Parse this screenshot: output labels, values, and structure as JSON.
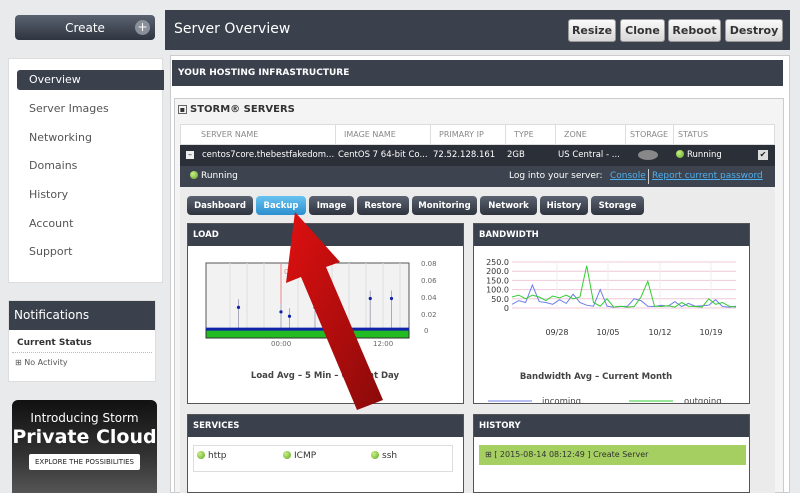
{
  "sidebar": {
    "create_label": "Create",
    "create_plus": "+",
    "items": [
      {
        "label": "Overview",
        "active": true
      },
      {
        "label": "Server Images"
      },
      {
        "label": "Networking"
      },
      {
        "label": "Domains"
      },
      {
        "label": "History"
      },
      {
        "label": "Account"
      },
      {
        "label": "Support"
      }
    ]
  },
  "notifications": {
    "title": "Notifications",
    "current_status": "Current Status",
    "entry": "No Activity"
  },
  "ad": {
    "line1": "Introducing Storm",
    "line2": "Private Cloud",
    "button": "EXPLORE THE POSSIBILITIES"
  },
  "header": {
    "title": "Server Overview",
    "buttons": [
      "Resize",
      "Clone",
      "Reboot",
      "Destroy"
    ]
  },
  "infra_title": "YOUR HOSTING INFRASTRUCTURE",
  "storm_title": "STORM® SERVERS",
  "table": {
    "columns": [
      "SERVER NAME",
      "IMAGE NAME",
      "PRIMARY IP",
      "TYPE",
      "ZONE",
      "STORAGE",
      "STATUS"
    ],
    "row": {
      "name": "centos7core.thebestfakedom...",
      "image": "CentOS 7 64-bit Co...",
      "ip": "72.52.128.161",
      "type": "2GB",
      "zone": "US Central - ...",
      "status": "Running",
      "checked": true
    }
  },
  "status_bar": {
    "status": "Running",
    "login_label": "Log into your server:",
    "console": "Console",
    "report": "Report current password"
  },
  "tabs": [
    {
      "label": "Dashboard"
    },
    {
      "label": "Backup",
      "active": true
    },
    {
      "label": "Image"
    },
    {
      "label": "Restore"
    },
    {
      "label": "Monitoring"
    },
    {
      "label": "Network"
    },
    {
      "label": "History"
    },
    {
      "label": "Storage"
    }
  ],
  "load": {
    "title": "LOAD",
    "caption": "Load Avg – 5 Min – Current Day",
    "marker": "Oct 21",
    "yticks": [
      "0.08",
      "0.06",
      "0.04",
      "0.02",
      "0"
    ],
    "xticks": [
      "00:00",
      "12:00"
    ],
    "spikes": [
      {
        "t": -5,
        "v": 0.03
      },
      {
        "t": 0,
        "v": 0.025
      },
      {
        "t": 1,
        "v": 0.02
      },
      {
        "t": 4,
        "v": 0.03
      },
      {
        "t": 10.5,
        "v": 0.04
      },
      {
        "t": 13,
        "v": 0.04
      }
    ],
    "baseline": 0.01
  },
  "bandwidth": {
    "title": "BANDWIDTH",
    "caption": "Bandwidth Avg – Current Month",
    "yticks": [
      "250.0",
      "200.0",
      "150.0",
      "100.0",
      "50.0",
      "0"
    ],
    "xticks": [
      "09/28",
      "10/05",
      "10/12",
      "10/19"
    ],
    "legend": [
      "incoming",
      "outgoing"
    ],
    "colors": {
      "incoming": "#6c7ee8",
      "outgoing": "#33cc33"
    },
    "incoming": [
      20,
      40,
      30,
      125,
      35,
      30,
      20,
      45,
      25,
      75,
      30,
      15,
      10,
      100,
      10,
      5,
      8,
      10,
      50,
      40,
      10,
      8,
      15,
      10,
      35,
      8,
      25,
      10,
      12,
      15,
      45,
      8,
      5,
      10
    ],
    "outgoing": [
      60,
      70,
      50,
      70,
      60,
      40,
      65,
      55,
      70,
      50,
      60,
      230,
      30,
      10,
      50,
      5,
      10,
      5,
      8,
      60,
      145,
      10,
      8,
      12,
      5,
      30,
      10,
      8,
      5,
      50,
      20,
      30,
      10,
      5
    ]
  },
  "services": {
    "title": "SERVICES",
    "items": [
      "http",
      "ICMP",
      "ssh"
    ]
  },
  "history": {
    "title": "HISTORY",
    "entry": "[ 2015-08-14 08:12:49 ] Create Server"
  }
}
